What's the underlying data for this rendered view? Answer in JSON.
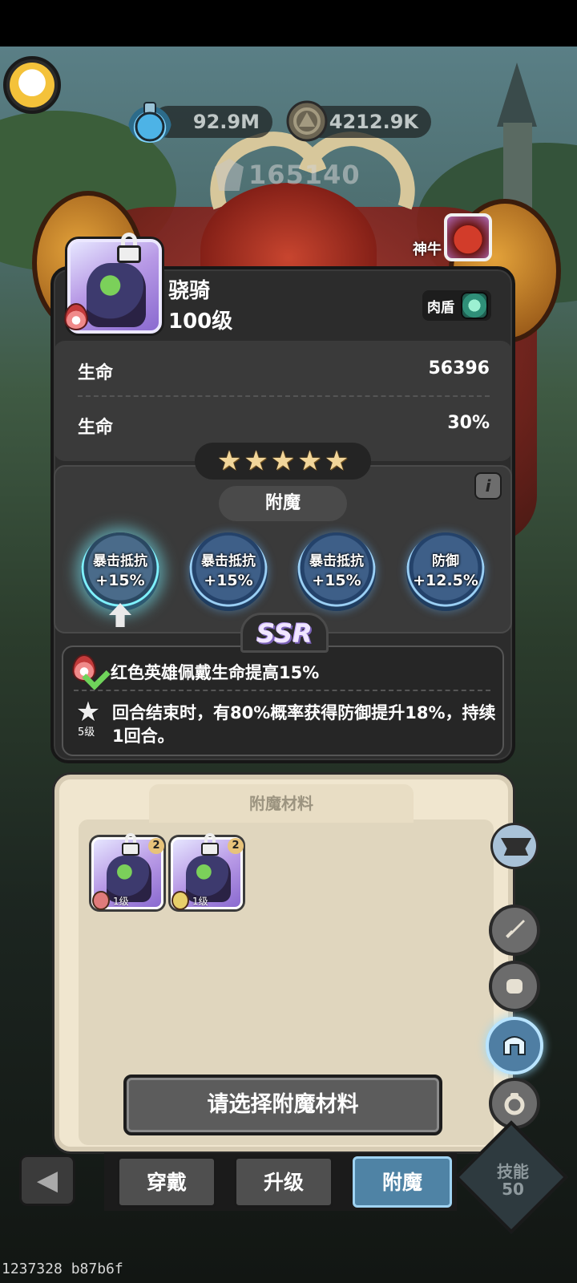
{
  "currency": {
    "potion_amount": "92.9M",
    "coin_amount": "4212.9K",
    "power": "165140"
  },
  "boss": {
    "name": "神牛"
  },
  "hero": {
    "name": "骁骑",
    "level": "100级",
    "role": "肉盾"
  },
  "stats": [
    {
      "label": "生命",
      "value": "56396"
    },
    {
      "label": "生命",
      "value": "30%"
    }
  ],
  "stars": {
    "count": 5,
    "glyph": "★"
  },
  "enchant": {
    "title": "附魔",
    "info_glyph": "i",
    "slots": [
      {
        "name": "暴击抵抗",
        "value": "+15%",
        "active": true
      },
      {
        "name": "暴击抵抗",
        "value": "+15%",
        "active": false
      },
      {
        "name": "暴击抵抗",
        "value": "+15%",
        "active": false
      },
      {
        "name": "防御",
        "value": "+12.5%",
        "active": false
      }
    ],
    "rarity": "SSR"
  },
  "skills": [
    {
      "text": "红色英雄佩戴生命提高15%"
    },
    {
      "text_line1": "回合结束时，有80%概率获得防御提升18%，持续",
      "text_line2": "1回合。",
      "level": "5级"
    }
  ],
  "materials": {
    "title": "附魔材料",
    "items": [
      {
        "level": "1级",
        "badge": "2",
        "element_color": "#e07b7b"
      },
      {
        "level": "1级",
        "badge": "2",
        "element_color": "#e8cf6a"
      }
    ],
    "select_button": "请选择附魔材料"
  },
  "side_buttons": [
    "sword-icon",
    "fist-icon",
    "helmet-icon",
    "ring-icon"
  ],
  "bottom_tabs": [
    {
      "label": "穿戴",
      "active": false
    },
    {
      "label": "升级",
      "active": false
    },
    {
      "label": "附魔",
      "active": true
    }
  ],
  "talent": {
    "label": "技能",
    "value": "50"
  },
  "footer": {
    "code": "1237328 b87b6f"
  },
  "colors": {
    "accent": "#4f83a5",
    "glow": "#7ff2ff",
    "panel": "#2c2c2c",
    "material_bg": "#f0e6cf"
  }
}
